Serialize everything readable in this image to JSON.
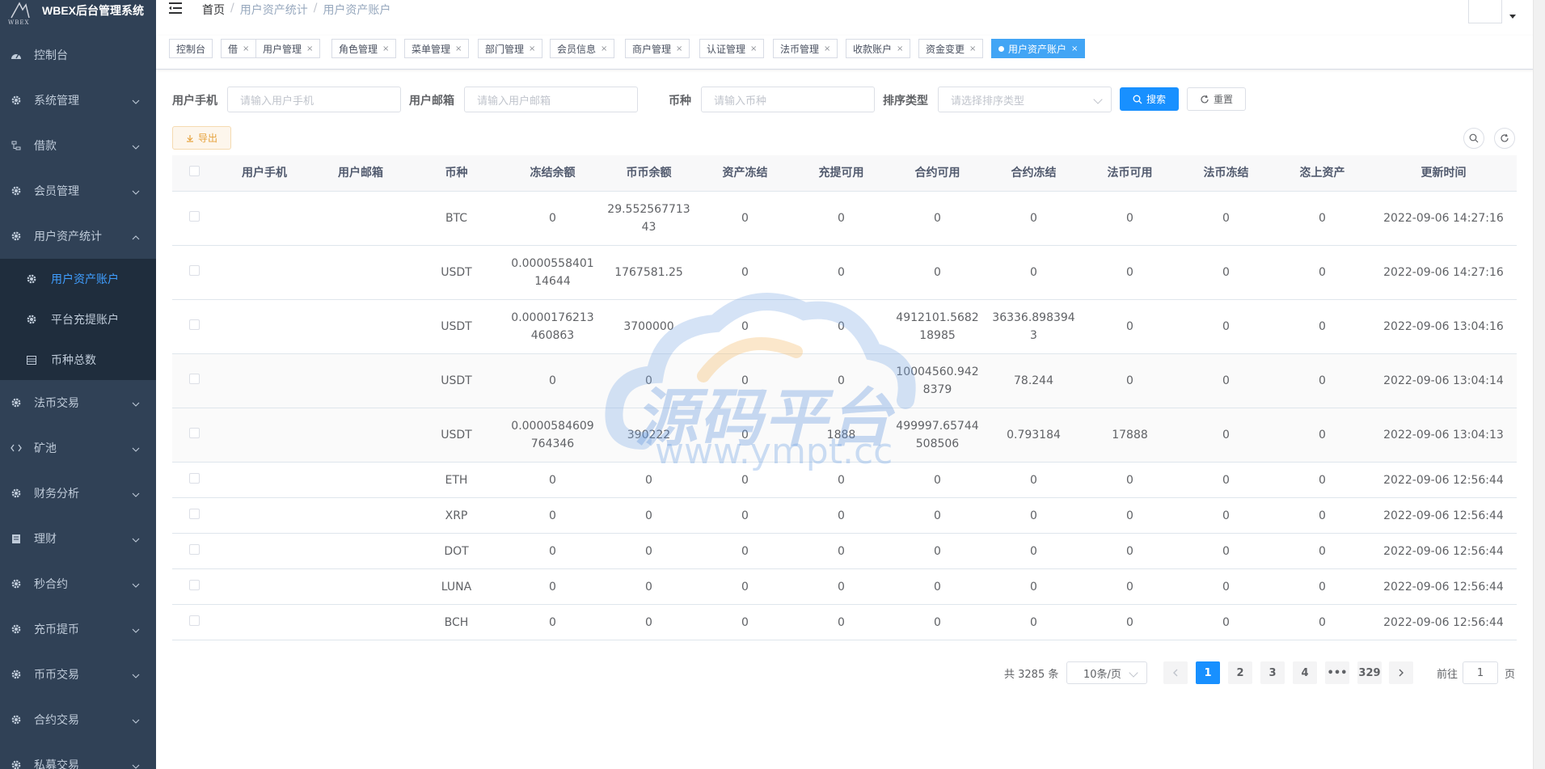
{
  "app": {
    "title": "WBEX后台管理系统",
    "logo_text": "WBEX"
  },
  "sidebar": {
    "items": [
      {
        "label": "控制台",
        "icon": "dashboard-icon",
        "arrow": false
      },
      {
        "label": "系统管理",
        "icon": "gear-icon",
        "arrow": "down"
      },
      {
        "label": "借款",
        "icon": "tree-icon",
        "arrow": "down"
      },
      {
        "label": "会员管理",
        "icon": "gear-icon",
        "arrow": "down"
      },
      {
        "label": "用户资产统计",
        "icon": "gear-icon",
        "arrow": "up"
      }
    ],
    "submenu": [
      {
        "label": "用户资产账户",
        "icon": "gear-icon",
        "active": true
      },
      {
        "label": "平台充提账户",
        "icon": "gear-icon",
        "active": false
      },
      {
        "label": "币种总数",
        "icon": "table-icon",
        "active": false
      }
    ],
    "items_after": [
      {
        "label": "法币交易",
        "icon": "gear-icon"
      },
      {
        "label": "矿池",
        "icon": "code-icon"
      },
      {
        "label": "财务分析",
        "icon": "gear-icon"
      },
      {
        "label": "理财",
        "icon": "document-icon"
      },
      {
        "label": "秒合约",
        "icon": "gear-icon"
      },
      {
        "label": "充币提币",
        "icon": "gear-icon"
      },
      {
        "label": "币币交易",
        "icon": "gear-icon"
      },
      {
        "label": "合约交易",
        "icon": "gear-icon"
      },
      {
        "label": "私募交易",
        "icon": "gear-icon"
      }
    ]
  },
  "breadcrumb": [
    "首页",
    "用户资产统计",
    "用户资产账户"
  ],
  "tags": [
    {
      "label": "控制台",
      "closable": false
    },
    {
      "label": "借",
      "closable": true
    },
    {
      "label": "用户管理",
      "closable": true
    },
    {
      "label": "角色管理",
      "closable": true
    },
    {
      "label": "菜单管理",
      "closable": true
    },
    {
      "label": "部门管理",
      "closable": true
    },
    {
      "label": "会员信息",
      "closable": true
    },
    {
      "label": "商户管理",
      "closable": true
    },
    {
      "label": "认证管理",
      "closable": true
    },
    {
      "label": "法币管理",
      "closable": true
    },
    {
      "label": "收款账户",
      "closable": true
    },
    {
      "label": "资金变更",
      "closable": true
    },
    {
      "label": "用户资产账户",
      "closable": true,
      "active": true
    }
  ],
  "search": {
    "phone_label": "用户手机",
    "phone_placeholder": "请输入用户手机",
    "email_label": "用户邮箱",
    "email_placeholder": "请输入用户邮箱",
    "coin_label": "币种",
    "coin_placeholder": "请输入币种",
    "sort_label": "排序类型",
    "sort_placeholder": "请选择排序类型",
    "search_btn": "搜索",
    "reset_btn": "重置"
  },
  "toolbar": {
    "export_btn": "导出"
  },
  "table": {
    "headers": [
      "用户手机",
      "用户邮箱",
      "币种",
      "冻结余额",
      "币币余额",
      "资产冻结",
      "充提可用",
      "合约可用",
      "合约冻结",
      "法币可用",
      "法币冻结",
      "恣上资产",
      "更新时间"
    ],
    "rows": [
      [
        "",
        "",
        "BTC",
        "0",
        "29.55256771343",
        "0",
        "0",
        "0",
        "0",
        "0",
        "0",
        "0",
        "2022-09-06 14:27:16"
      ],
      [
        "",
        "",
        "USDT",
        "0.000055840114644",
        "1767581.25",
        "0",
        "0",
        "0",
        "0",
        "0",
        "0",
        "0",
        "2022-09-06 14:27:16"
      ],
      [
        "",
        "",
        "USDT",
        "0.0000176213460863",
        "3700000",
        "0",
        "0",
        "4912101.568218985",
        "36336.8983943",
        "0",
        "0",
        "0",
        "2022-09-06 13:04:16"
      ],
      [
        "",
        "",
        "USDT",
        "0",
        "0",
        "0",
        "0",
        "10004560.9428379",
        "78.244",
        "0",
        "0",
        "0",
        "2022-09-06 13:04:14"
      ],
      [
        "",
        "",
        "USDT",
        "0.0000584609764346",
        "390222",
        "0",
        "1888",
        "499997.65744508506",
        "0.793184",
        "17888",
        "0",
        "0",
        "2022-09-06 13:04:13"
      ],
      [
        "",
        "",
        "ETH",
        "0",
        "0",
        "0",
        "0",
        "0",
        "0",
        "0",
        "0",
        "0",
        "2022-09-06 12:56:44"
      ],
      [
        "",
        "",
        "XRP",
        "0",
        "0",
        "0",
        "0",
        "0",
        "0",
        "0",
        "0",
        "0",
        "2022-09-06 12:56:44"
      ],
      [
        "",
        "",
        "DOT",
        "0",
        "0",
        "0",
        "0",
        "0",
        "0",
        "0",
        "0",
        "0",
        "2022-09-06 12:56:44"
      ],
      [
        "",
        "",
        "LUNA",
        "0",
        "0",
        "0",
        "0",
        "0",
        "0",
        "0",
        "0",
        "0",
        "2022-09-06 12:56:44"
      ],
      [
        "",
        "",
        "BCH",
        "0",
        "0",
        "0",
        "0",
        "0",
        "0",
        "0",
        "0",
        "0",
        "2022-09-06 12:56:44"
      ]
    ]
  },
  "pagination": {
    "total": "共 3285 条",
    "page_size": "10条/页",
    "pages": [
      "1",
      "2",
      "3",
      "4",
      "•••",
      "329"
    ],
    "current": "1",
    "goto_prefix": "前往",
    "goto_value": "1",
    "goto_suffix": "页"
  },
  "watermark": {
    "text": "源码平台",
    "url": "www.ympt.cc"
  },
  "colors": {
    "sidebar_bg": "#304156",
    "submenu_bg": "#1f2d3d",
    "primary": "#1890ff",
    "active_text": "#409eff"
  }
}
